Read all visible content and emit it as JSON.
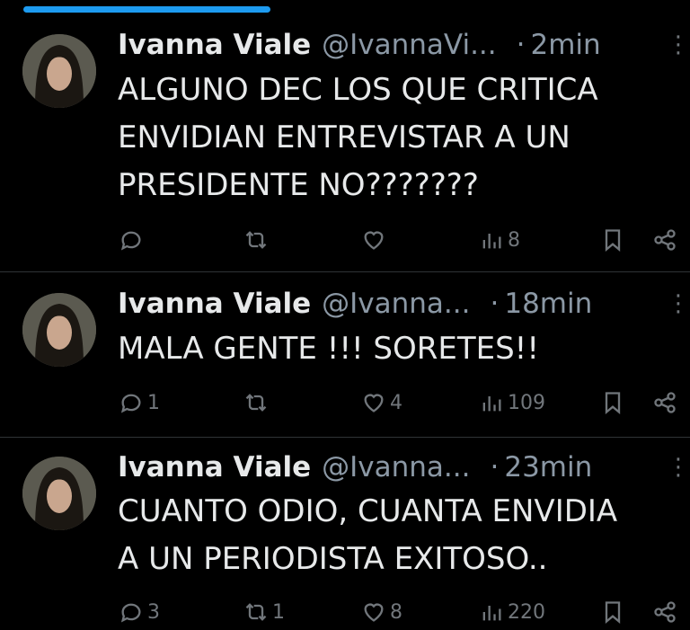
{
  "tweets": [
    {
      "name": "Ivanna Viale",
      "handle": "@IvannaVi...",
      "separator": "·",
      "time": "2min",
      "text": "ALGUNO DEC LOS QUE CRITICA\nENVIDIAN ENTREVISTAR A UN\nPRESIDENTE NO???????",
      "replies": "",
      "retweets": "",
      "likes": "",
      "views": "8"
    },
    {
      "name": "Ivanna Viale",
      "handle": "@Ivanna...",
      "separator": "·",
      "time": "18min",
      "text": "MALA GENTE !!! SORETES!!",
      "replies": "1",
      "retweets": "",
      "likes": "4",
      "views": "109"
    },
    {
      "name": "Ivanna Viale",
      "handle": "@Ivanna...",
      "separator": "·",
      "time": "23min",
      "text": "CUANTO ODIO, CUANTA ENVIDIA\nA UN PERIODISTA EXITOSO..",
      "replies": "3",
      "retweets": "1",
      "likes": "8",
      "views": "220"
    }
  ],
  "more_glyph": "⋮"
}
